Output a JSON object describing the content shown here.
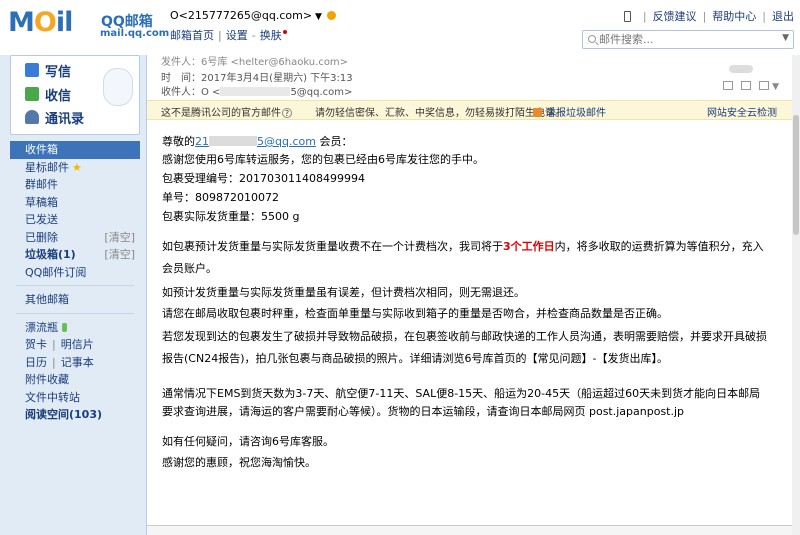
{
  "header": {
    "logo_mail": "M",
    "logo_o": "O",
    "logo_il": "il",
    "logo_qq": "QQ邮箱",
    "logo_domain": "mail.qq.com",
    "account_prefix": "O<215777265@qq.com>",
    "links": [
      "邮箱首页",
      "设置",
      "换肤"
    ],
    "top_links": [
      "反馈建议",
      "帮助中心",
      "退出"
    ],
    "search_placeholder": "邮件搜索..."
  },
  "sidebar": {
    "write": "写信",
    "receive": "收信",
    "contacts": "通讯录",
    "folders": [
      {
        "label": "收件箱"
      },
      {
        "label": "星标邮件"
      },
      {
        "label": "群邮件"
      },
      {
        "label": "草稿箱"
      },
      {
        "label": "已发送"
      },
      {
        "label": "已删除",
        "action": "[清空]"
      },
      {
        "label": "垃圾箱(1)",
        "action": "[清空]"
      },
      {
        "label": "QQ邮件订阅"
      }
    ],
    "other_mailboxes": "其他邮箱",
    "apps": [
      {
        "label": "漂流瓶"
      },
      {
        "label": "贺卡",
        "label2": "明信片"
      },
      {
        "label": "日历",
        "label2": "记事本"
      },
      {
        "label": "附件收藏"
      },
      {
        "label": "文件中转站"
      },
      {
        "label": "阅读空间(103)"
      }
    ]
  },
  "message": {
    "from_line": "发件人：6号库 <helter@6haoku.com>",
    "time_line": "时　间：2017年3月4日(星期六) 下午3:13",
    "to_prefix": "收件人：O <",
    "to_suffix": "5@qq.com>",
    "warning": "这不是腾讯公司的官方邮件",
    "warning_tip": "请勿轻信密保、汇款、中奖信息，勿轻易拨打陌生电话。",
    "report": "举报垃圾邮件",
    "safety": "网站安全云检测"
  },
  "body": {
    "greeting_prefix": "尊敬的",
    "greeting_link_a": "21",
    "greeting_link_b": "5@qq.com",
    "greeting_suffix": " 会员：",
    "l2": "感谢您使用6号库转运服务，您的包裹已经由6号库发往您的手中。",
    "l3": "包裹受理编号：201703011408499994",
    "l4": "单号：809872010072",
    "l5": "包裹实际发货重量：5500 g",
    "l6a": "如包裹预计发货重量与实际发货重量收费不在一个计费档次，我司将于",
    "l6b": "3个工作日",
    "l6c": "内，将多收取的运费折算为等值积分，充入",
    "l7": "会员账户。",
    "l8": "如预计发货重量与实际发货重量虽有误差，但计费档次相同，则无需退还。",
    "l9": "请您在邮局收取包裹时秤重，检查面单重量与实际收到箱子的重量是否吻合，并检查商品数量是否正确。",
    "l10": "若您发现到达的包裹发生了破损并导致物品破损，在包裹签收前与邮政快递的工作人员沟通，表明需要赔偿，并要求开具破损",
    "l11": "报告(CN24报告)，拍几张包裹与商品破损的照片。详细请浏览6号库首页的【常见问题】-【发货出库】。",
    "l12": "通常情况下EMS到货天数为3-7天、航空便7-11天、SAL便8-15天、船运为20-45天（船运超过60天未到货才能向日本邮局",
    "l13": "要求查询进展，请海运的客户需要耐心等候）。货物的日本运输段，请查询日本邮局网页 post.japanpost.jp",
    "l14": "如有任何疑问，请咨询6号库客服。",
    "l15": "感谢您的惠顾，祝您海淘愉快。"
  },
  "colors": {
    "brand": "#2b6fb6",
    "sidebar_bg": "#e1ebf6",
    "active": "#3d73b8",
    "warn_bg": "#fdf7d9",
    "highlight": "#d00000"
  }
}
